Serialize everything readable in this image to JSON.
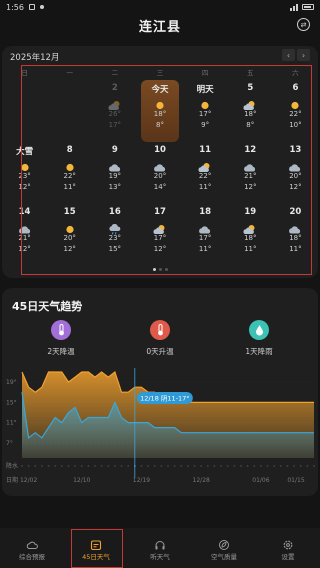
{
  "status_bar": {
    "time": "1:56"
  },
  "header": {
    "title": "连江县",
    "action_icon": "swap-icon"
  },
  "calendar": {
    "month_label": "2025年12月",
    "prev_icon": "chevron-left-icon",
    "next_icon": "chevron-right-icon",
    "weekdays": [
      "日",
      "一",
      "二",
      "三",
      "四",
      "五",
      "六"
    ],
    "weeks": [
      [
        {
          "label": "",
          "icon": "none",
          "hi": "",
          "lo": "",
          "state": "empty"
        },
        {
          "label": "",
          "icon": "none",
          "hi": "",
          "lo": "",
          "state": "empty"
        },
        {
          "label": "2",
          "icon": "partly-cloudy-icon",
          "hi": "26°",
          "lo": "17°",
          "state": "past"
        },
        {
          "label": "今天",
          "icon": "sun-icon",
          "hi": "18°",
          "lo": "8°",
          "state": "today"
        },
        {
          "label": "明天",
          "icon": "sun-icon",
          "hi": "17°",
          "lo": "9°",
          "state": "normal"
        },
        {
          "label": "5",
          "icon": "partly-cloudy-icon",
          "hi": "18°",
          "lo": "8°",
          "state": "normal"
        },
        {
          "label": "6",
          "icon": "sun-icon",
          "hi": "22°",
          "lo": "10°",
          "state": "normal"
        }
      ],
      [
        {
          "label": "大雪",
          "icon": "sun-icon",
          "hi": "23°",
          "lo": "12°",
          "state": "normal"
        },
        {
          "label": "8",
          "icon": "sun-icon",
          "hi": "22°",
          "lo": "11°",
          "state": "normal"
        },
        {
          "label": "9",
          "icon": "cloud-icon",
          "hi": "19°",
          "lo": "13°",
          "state": "normal"
        },
        {
          "label": "10",
          "icon": "cloud-icon",
          "hi": "20°",
          "lo": "14°",
          "state": "normal"
        },
        {
          "label": "11",
          "icon": "partly-cloudy-icon",
          "hi": "22°",
          "lo": "11°",
          "state": "normal"
        },
        {
          "label": "12",
          "icon": "cloud-icon",
          "hi": "21°",
          "lo": "12°",
          "state": "normal"
        },
        {
          "label": "13",
          "icon": "cloud-icon",
          "hi": "20°",
          "lo": "12°",
          "state": "normal"
        }
      ],
      [
        {
          "label": "14",
          "icon": "cloud-icon",
          "hi": "21°",
          "lo": "12°",
          "state": "normal"
        },
        {
          "label": "15",
          "icon": "sun-icon",
          "hi": "20°",
          "lo": "12°",
          "state": "normal"
        },
        {
          "label": "16",
          "icon": "rain-icon",
          "hi": "23°",
          "lo": "15°",
          "state": "normal"
        },
        {
          "label": "17",
          "icon": "partly-cloudy-icon",
          "hi": "17°",
          "lo": "12°",
          "state": "normal"
        },
        {
          "label": "18",
          "icon": "cloud-icon",
          "hi": "17°",
          "lo": "11°",
          "state": "normal"
        },
        {
          "label": "19",
          "icon": "partly-cloudy-icon",
          "hi": "18°",
          "lo": "11°",
          "state": "normal"
        },
        {
          "label": "20",
          "icon": "cloud-icon",
          "hi": "18°",
          "lo": "11°",
          "state": "normal"
        }
      ]
    ]
  },
  "trend": {
    "title": "45日天气趋势",
    "stats": [
      {
        "label": "2天降温",
        "icon": "thermometer-down-icon",
        "color": "#a26fd6"
      },
      {
        "label": "0天升温",
        "icon": "thermometer-up-icon",
        "color": "#e05a4b"
      },
      {
        "label": "1天降雨",
        "icon": "raindrop-icon",
        "color": "#3cc2b4"
      }
    ],
    "tooltip": "12/18 阴11-17°"
  },
  "chart_data": {
    "type": "area",
    "ylabels": [
      "19°",
      "15°",
      "11°",
      "7°"
    ],
    "ylim": [
      4,
      21
    ],
    "row_labels": [
      "降水",
      "日期"
    ],
    "xticks": [
      "12/02",
      "12/10",
      "12/19",
      "12/28",
      "01/06",
      "01/15"
    ],
    "x": [
      1,
      2,
      3,
      4,
      5,
      6,
      7,
      8,
      9,
      10,
      11,
      12,
      13,
      14,
      15,
      16,
      17,
      18,
      19,
      20,
      21,
      22,
      23,
      24,
      25,
      26,
      27,
      28,
      29,
      30,
      31,
      32,
      33,
      34,
      35,
      36,
      37,
      38,
      39,
      40,
      41,
      42,
      43,
      44,
      45
    ],
    "series": [
      {
        "values": [
          26,
          18,
          17,
          18,
          22,
          23,
          22,
          19,
          20,
          22,
          21,
          20,
          21,
          20,
          23,
          17,
          17,
          18,
          18,
          17,
          17,
          16,
          16,
          15,
          15,
          15,
          15,
          15,
          15,
          15,
          15,
          15,
          15,
          15,
          15,
          15,
          15,
          15,
          15,
          15,
          15,
          15,
          15,
          15,
          15
        ]
      },
      {
        "values": [
          17,
          8,
          9,
          8,
          10,
          12,
          11,
          13,
          14,
          11,
          12,
          12,
          12,
          12,
          15,
          12,
          11,
          11,
          11,
          11,
          10,
          10,
          10,
          10,
          9,
          9,
          9,
          9,
          9,
          9,
          9,
          9,
          9,
          9,
          9,
          9,
          9,
          9,
          9,
          9,
          9,
          9,
          9,
          9,
          9
        ]
      }
    ],
    "highlight_x": 18,
    "colors": {
      "hi": "#f2a12e",
      "lo": "#3aa7d8"
    }
  },
  "bottom_nav": {
    "items": [
      {
        "label": "综合预报",
        "icon": "cloud-outline-icon",
        "active": false
      },
      {
        "label": "45日天气",
        "icon": "calendar-icon",
        "active": true
      },
      {
        "label": "听天气",
        "icon": "headphones-icon",
        "active": false
      },
      {
        "label": "空气质量",
        "icon": "leaf-icon",
        "active": false
      },
      {
        "label": "设置",
        "icon": "gear-icon",
        "active": false
      }
    ]
  }
}
